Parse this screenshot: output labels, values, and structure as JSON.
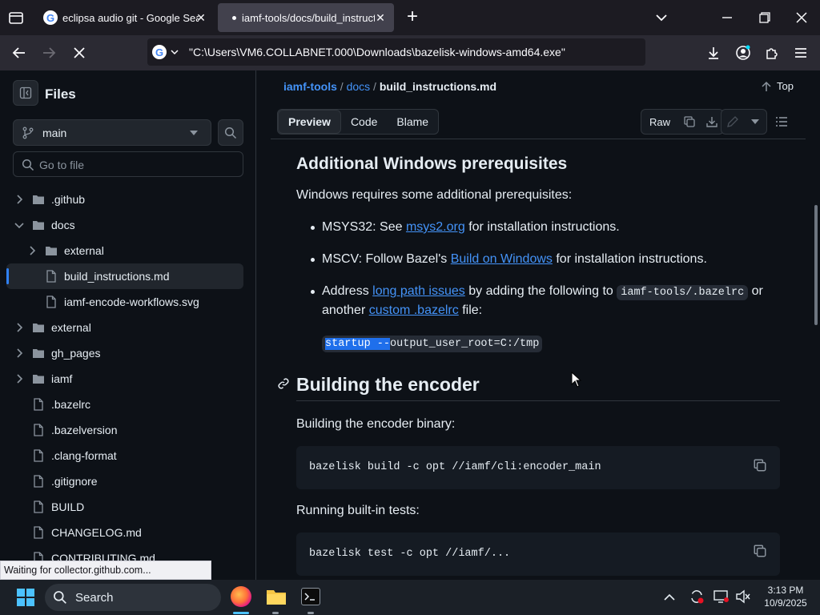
{
  "browser": {
    "tabs": [
      {
        "title": "eclipsa audio git - Google Searc",
        "active": false
      },
      {
        "title": "iamf-tools/docs/build_instructio",
        "active": true
      }
    ],
    "url": "\"C:\\Users\\VM6.COLLABNET.000\\Downloads\\bazelisk-windows-amd64.exe\"",
    "status": "Waiting for collector.github.com..."
  },
  "sidebar": {
    "title": "Files",
    "branch": "main",
    "goto_placeholder": "Go to file",
    "tree": [
      {
        "label": ".github",
        "type": "folder",
        "expanded": false,
        "depth": 0
      },
      {
        "label": "docs",
        "type": "folder",
        "expanded": true,
        "depth": 0
      },
      {
        "label": "external",
        "type": "folder",
        "expanded": false,
        "depth": 1
      },
      {
        "label": "build_instructions.md",
        "type": "file",
        "depth": 1,
        "active": true
      },
      {
        "label": "iamf-encode-workflows.svg",
        "type": "file",
        "depth": 1
      },
      {
        "label": "external",
        "type": "folder",
        "expanded": false,
        "depth": 0
      },
      {
        "label": "gh_pages",
        "type": "folder",
        "expanded": false,
        "depth": 0
      },
      {
        "label": "iamf",
        "type": "folder",
        "expanded": false,
        "depth": 0
      },
      {
        "label": ".bazelrc",
        "type": "file",
        "depth": 0
      },
      {
        "label": ".bazelversion",
        "type": "file",
        "depth": 0
      },
      {
        "label": ".clang-format",
        "type": "file",
        "depth": 0
      },
      {
        "label": ".gitignore",
        "type": "file",
        "depth": 0
      },
      {
        "label": "BUILD",
        "type": "file",
        "depth": 0
      },
      {
        "label": "CHANGELOG.md",
        "type": "file",
        "depth": 0
      },
      {
        "label": "CONTRIBUTING.md",
        "type": "file",
        "depth": 0
      }
    ]
  },
  "header": {
    "breadcrumb": {
      "repo": "iamf-tools",
      "sep1": "/",
      "dir": "docs",
      "sep2": "/",
      "file": "build_instructions.md"
    },
    "top_label": "Top",
    "tabs": {
      "preview": "Preview",
      "code": "Code",
      "blame": "Blame"
    },
    "raw_label": "Raw"
  },
  "doc": {
    "h_prereq": "Additional Windows prerequisites",
    "intro": "Windows requires some additional prerequisites:",
    "b1": {
      "pre": "MSYS32: See ",
      "link": "msys2.org",
      "post": " for installation instructions."
    },
    "b2": {
      "pre": "MSCV: Follow Bazel's ",
      "link": "Build on Windows",
      "post": " for installation instructions."
    },
    "b3": {
      "pre": "Address ",
      "link": "long path issues",
      "mid": " by adding the following to ",
      "code": "iamf-tools/.bazelrc",
      "post": " or",
      "line2_pre": "another ",
      "link2": "custom .bazelrc",
      "line2_post": " file:"
    },
    "startup_sel": "startup --",
    "startup_rest": "output_user_root=C:/tmp",
    "h_build": "Building the encoder",
    "build_para": "Building the encoder binary:",
    "build_cmd": "bazelisk build -c opt //iamf/cli:encoder_main",
    "test_para": "Running built-in tests:",
    "test_cmd": "bazelisk test -c opt //iamf/..."
  },
  "taskbar": {
    "search": "Search",
    "time": "3:13 PM",
    "date": "10/9/2025"
  }
}
